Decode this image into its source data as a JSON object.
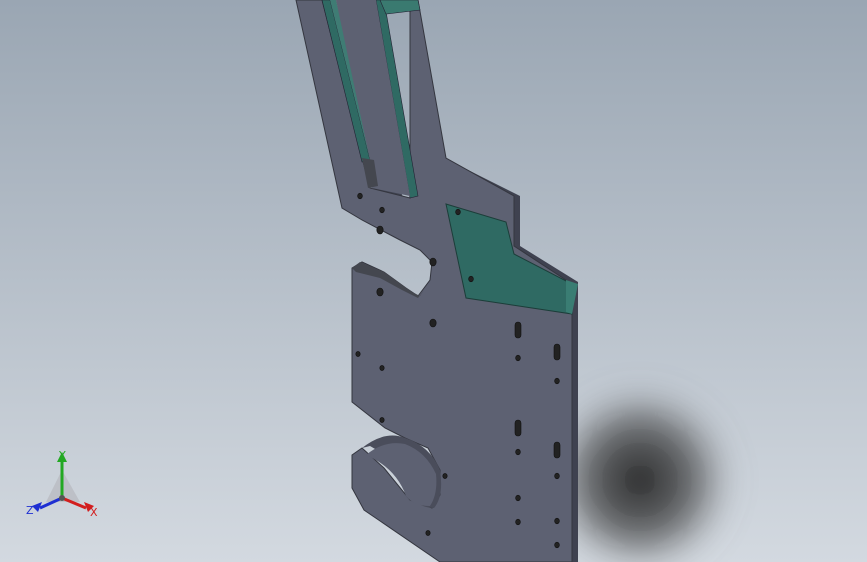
{
  "viewport": {
    "background_top": "#9aa6b3",
    "background_bottom": "#d2d8df",
    "part_face_color": "#5d6172",
    "part_edge_color": "#3b3e4a",
    "part_side_color": "#4a4d5b",
    "selected_face_color": "#2f6a63",
    "shadow_color": "#2a2a2a"
  },
  "triad": {
    "x_label": "X",
    "y_label": "Y",
    "z_label": "Z",
    "x_color": "#d21e1e",
    "y_color": "#23a823",
    "z_color": "#1e2fd2"
  }
}
